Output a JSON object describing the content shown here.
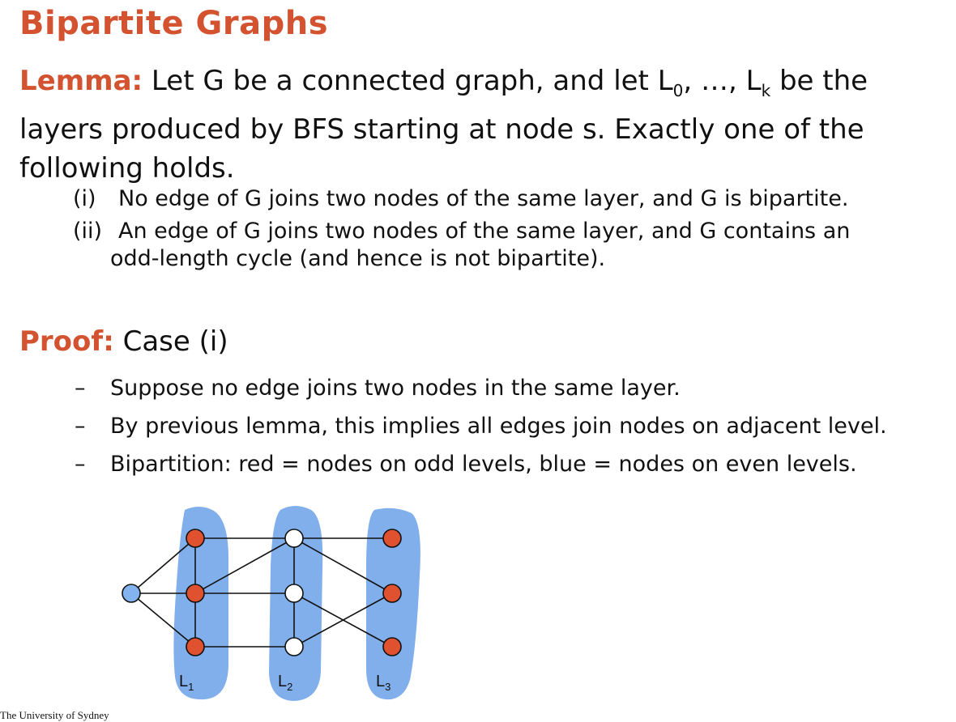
{
  "slide": {
    "title": "Bipartite Graphs",
    "lemma": {
      "label": "Lemma:",
      "text_1": " Let G be a connected graph, and let L",
      "sub_0": "0",
      "text_2": ", …, L",
      "sub_k": "k",
      "text_3": " be the layers produced by BFS starting at node s.  Exactly one of the following holds."
    },
    "cases": [
      {
        "num": "(i)",
        "text": "No edge of G joins two nodes of the same layer, and G is bipartite."
      },
      {
        "num": "(ii)",
        "text": "An edge of G joins two nodes of the same layer, and G contains an",
        "cont": "odd-length cycle (and hence is not bipartite)."
      }
    ],
    "proof": {
      "label": "Proof:",
      "text": " Case (i)"
    },
    "bullets": [
      "Suppose no edge joins two nodes in the same layer.",
      "By previous lemma, this implies all edges join nodes on adjacent level.",
      "Bipartition:  red = nodes on odd levels, blue = nodes on even levels."
    ],
    "bullet_dash": "–",
    "footer": "The University of Sydney"
  },
  "diagram": {
    "layer_labels": [
      {
        "letter": "L",
        "sub": "1"
      },
      {
        "letter": "L",
        "sub": "2"
      },
      {
        "letter": "L",
        "sub": "3"
      }
    ],
    "colors": {
      "red": "#e0522f",
      "blue": "#84b4f0",
      "white": "#ffffff",
      "band": "#80afeb"
    }
  }
}
